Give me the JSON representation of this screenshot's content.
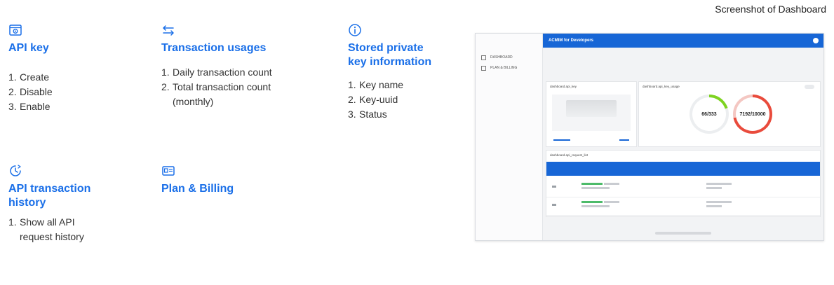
{
  "caption": "Screenshot of Dashboard",
  "features": {
    "api_key": {
      "title": "API key",
      "icon": "api-key-icon",
      "items": [
        "Create",
        "Disable",
        "Enable"
      ]
    },
    "transaction_usages": {
      "title": "Transaction usages",
      "icon": "arrows-swap-icon",
      "items": [
        "Daily transaction count",
        "Total transaction count",
        "(monthly)"
      ]
    },
    "stored_key": {
      "title_line1": "Stored private",
      "title_line2": "key information",
      "icon": "info-icon",
      "items": [
        "Key name",
        "Key-uuid",
        "Status"
      ]
    },
    "history": {
      "title_line1": "API transaction",
      "title_line2": "history",
      "icon": "clock-icon",
      "items": [
        "Show all API",
        "request history"
      ]
    },
    "plan": {
      "title": "Plan & Billing",
      "icon": "billing-icon"
    }
  },
  "numbers": [
    "1.",
    "2.",
    "3."
  ],
  "dashboard": {
    "app_title": "ACMIM for Developers",
    "sidebar": [
      "DASHBOARD",
      "PLAN & BILLING"
    ],
    "api_key_card_title": "dashboard.api_key",
    "usage_card_title": "dashboard.api_key_usage",
    "gauge_daily": "66/333",
    "gauge_total": "7192/10000",
    "history_title": "dashboard.api_request_list",
    "daily_fraction": 0.198,
    "total_fraction": 0.719,
    "colors": {
      "accent": "#1a6fe8",
      "daily": "#7ed321",
      "total": "#e94b3c"
    }
  }
}
